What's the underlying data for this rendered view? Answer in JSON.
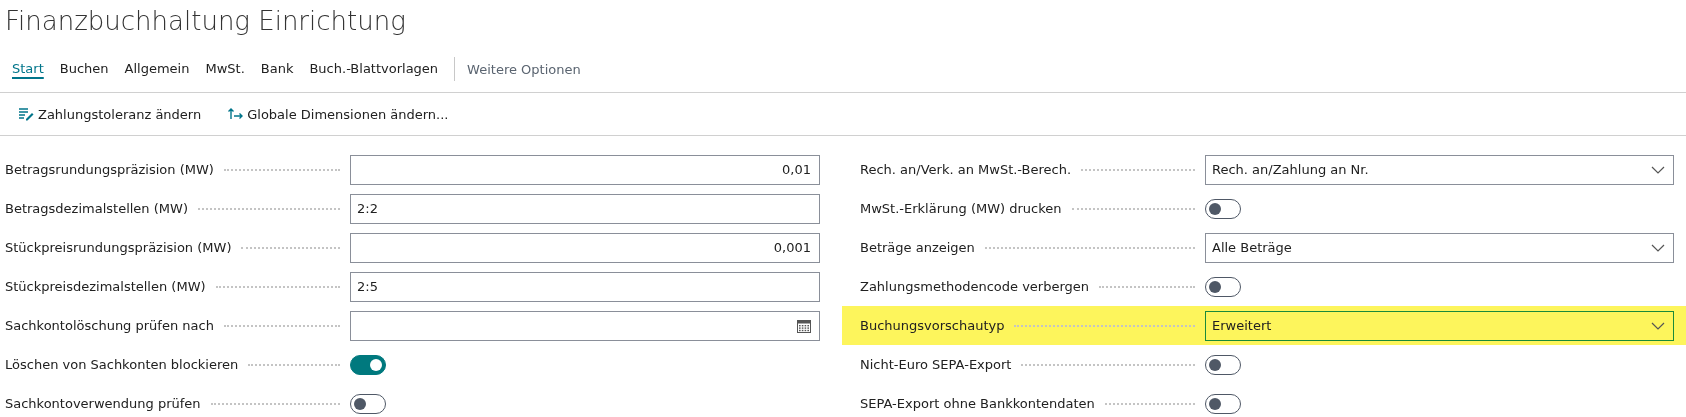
{
  "window": {
    "title": "Finanzbuchhaltung Einrichtung"
  },
  "tabs": [
    {
      "label": "Start",
      "selected": true
    },
    {
      "label": "Buchen",
      "selected": false
    },
    {
      "label": "Allgemein",
      "selected": false
    },
    {
      "label": "MwSt.",
      "selected": false
    },
    {
      "label": "Bank",
      "selected": false
    },
    {
      "label": "Buch.-Blattvorlagen",
      "selected": false
    }
  ],
  "more_options": "Weitere Optionen",
  "actions": [
    {
      "label": "Zahlungstoleranz ändern",
      "kind": "tolerance"
    },
    {
      "label": "Globale Dimensionen ändern...",
      "kind": "dimensions"
    }
  ],
  "columns": [
    [
      {
        "label": "Betragsrundungspräzision (MW)",
        "kind": "number",
        "value": "0,01"
      },
      {
        "label": "Betragsdezimalstellen (MW)",
        "kind": "text",
        "value": "2:2"
      },
      {
        "label": "Stückpreisrundungspräzision (MW)",
        "kind": "number",
        "value": "0,001"
      },
      {
        "label": "Stückpreisdezimalstellen (MW)",
        "kind": "text",
        "value": "2:5"
      },
      {
        "label": "Sachkontolöschung prüfen nach",
        "kind": "date"
      },
      {
        "label": "Löschen von Sachkonten blockieren",
        "kind": "toggle",
        "on": true
      },
      {
        "label": "Sachkontoverwendung prüfen",
        "kind": "toggle",
        "on": false
      }
    ],
    [
      {
        "label": "Rech. an/Verk. an MwSt.-Berech.",
        "kind": "select",
        "value": "Rech. an/Zahlung an Nr.",
        "highlighted": false
      },
      {
        "label": "MwSt.-Erklärung (MW) drucken",
        "kind": "toggle",
        "on": false,
        "highlighted": false
      },
      {
        "label": "Beträge anzeigen",
        "kind": "select",
        "value": "Alle Beträge",
        "highlighted": false
      },
      {
        "label": "Zahlungsmethodencode verbergen",
        "kind": "toggle",
        "on": false,
        "highlighted": false
      },
      {
        "label": "Buchungsvorschautyp",
        "kind": "select",
        "value": "Erweitert",
        "highlighted": true
      },
      {
        "label": "Nicht-Euro SEPA-Export",
        "kind": "toggle",
        "on": false,
        "highlighted": false
      },
      {
        "label": "SEPA-Export ohne Bankkontendaten",
        "kind": "toggle",
        "on": false,
        "highlighted": false
      }
    ]
  ]
}
